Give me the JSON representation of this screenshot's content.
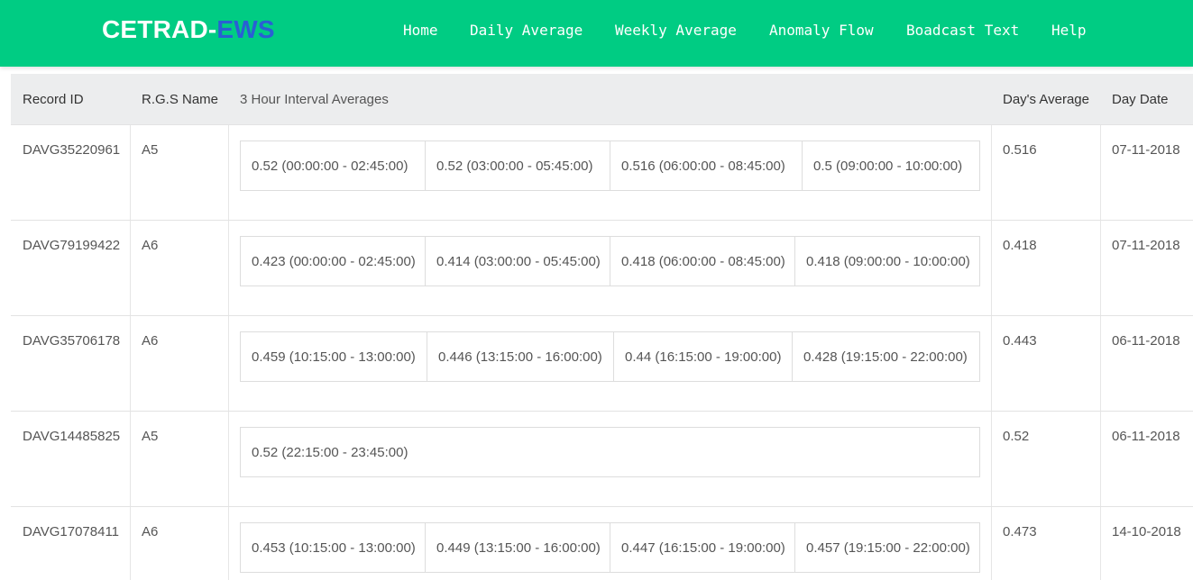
{
  "brand": {
    "part1": "CETRAD-",
    "part2": "EWS"
  },
  "nav": {
    "home": "Home",
    "daily": "Daily Average",
    "weekly": "Weekly Average",
    "anomaly": "Anomaly Flow",
    "broadcast": "Boadcast Text",
    "help": "Help"
  },
  "table": {
    "headers": {
      "record_id": "Record ID",
      "rgs_name": "R.G.S Name",
      "intervals": "3 Hour Interval Averages",
      "day_avg": "Day's Average",
      "day_date": "Day Date"
    },
    "rows": [
      {
        "record_id": "DAVG35220961",
        "rgs": "A5",
        "intervals": [
          "0.52 (00:00:00 - 02:45:00)",
          "0.52 (03:00:00 - 05:45:00)",
          "0.516 (06:00:00 - 08:45:00)",
          "0.5 (09:00:00 - 10:00:00)"
        ],
        "avg": "0.516",
        "date": "07-11-2018"
      },
      {
        "record_id": "DAVG79199422",
        "rgs": "A6",
        "intervals": [
          "0.423 (00:00:00 - 02:45:00)",
          "0.414 (03:00:00 - 05:45:00)",
          "0.418 (06:00:00 - 08:45:00)",
          "0.418 (09:00:00 - 10:00:00)"
        ],
        "avg": "0.418",
        "date": "07-11-2018"
      },
      {
        "record_id": "DAVG35706178",
        "rgs": "A6",
        "intervals": [
          "0.459 (10:15:00 - 13:00:00)",
          "0.446 (13:15:00 - 16:00:00)",
          "0.44 (16:15:00 - 19:00:00)",
          "0.428 (19:15:00 - 22:00:00)"
        ],
        "avg": "0.443",
        "date": "06-11-2018"
      },
      {
        "record_id": "DAVG14485825",
        "rgs": "A5",
        "intervals": [
          "0.52 (22:15:00 - 23:45:00)"
        ],
        "avg": "0.52",
        "date": "06-11-2018"
      },
      {
        "record_id": "DAVG17078411",
        "rgs": "A6",
        "intervals": [
          "0.453 (10:15:00 - 13:00:00)",
          "0.449 (13:15:00 - 16:00:00)",
          "0.447 (16:15:00 - 19:00:00)",
          "0.457 (19:15:00 - 22:00:00)"
        ],
        "avg": "0.473",
        "date": "14-10-2018"
      }
    ]
  },
  "colors": {
    "navbar": "#00cc83",
    "brand_accent": "#2a5fd4",
    "header_bg": "#ecedee"
  }
}
